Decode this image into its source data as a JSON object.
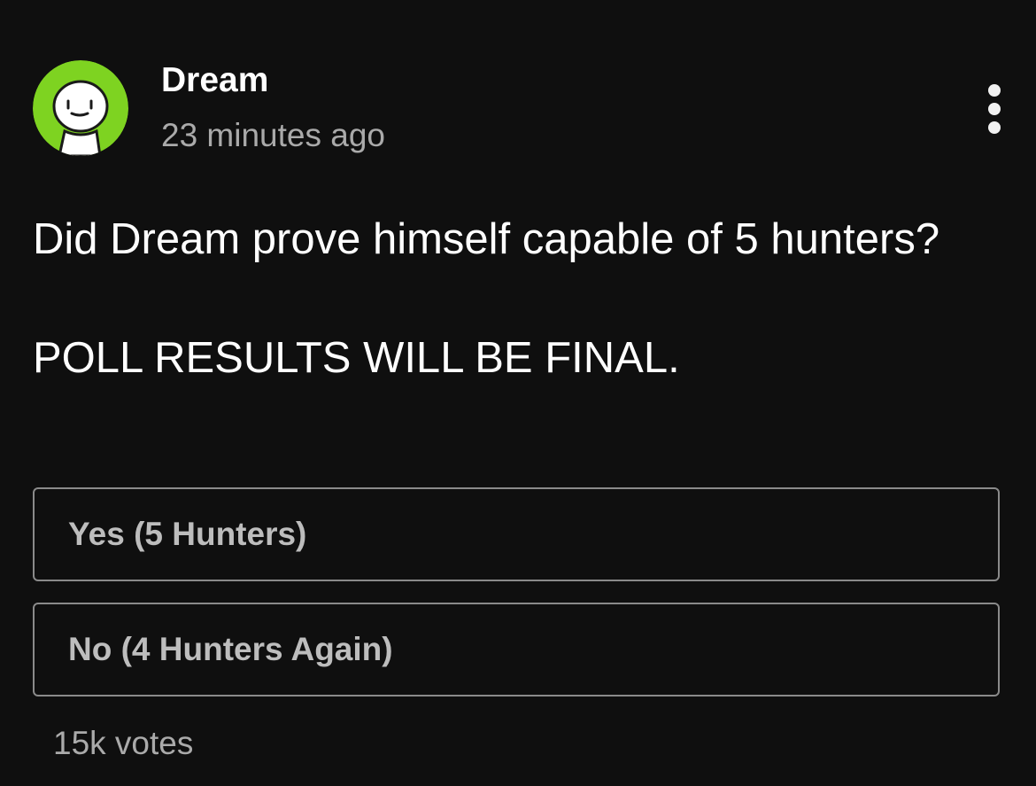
{
  "post": {
    "author": {
      "name": "Dream",
      "timestamp": "23 minutes ago",
      "avatar_icon": "dream-smiley-avatar",
      "avatar_color": "#7ed321"
    },
    "menu_icon": "more-vertical-icon",
    "text_lines": [
      "Did Dream prove himself capable of 5 hunters?",
      "POLL RESULTS WILL BE FINAL."
    ],
    "poll": {
      "options": [
        {
          "label": "Yes (5 Hunters)"
        },
        {
          "label": "No (4 Hunters Again)"
        }
      ],
      "votes": "15k votes"
    }
  },
  "colors": {
    "background": "#0f0f0f",
    "text_primary": "#ffffff",
    "text_secondary": "#aaaaaa",
    "option_border": "#8a8a8a"
  }
}
